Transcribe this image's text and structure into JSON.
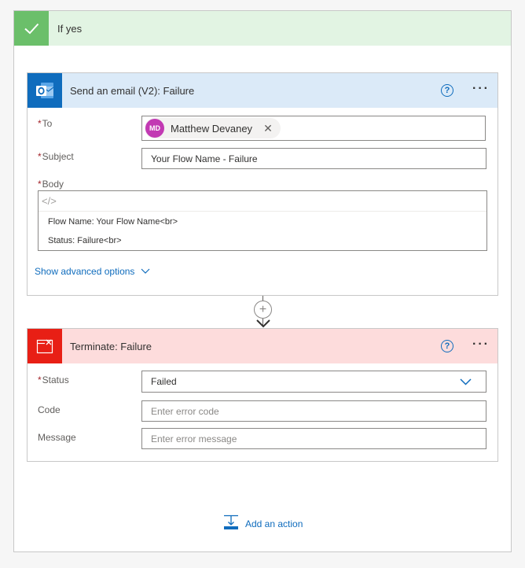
{
  "branch": {
    "title": "If yes",
    "accent_color": "#6bbf6a",
    "header_color": "#e2f4e3"
  },
  "email_card": {
    "title": "Send an email (V2): Failure",
    "icon": "outlook-icon",
    "header_color": "#dbeaf8",
    "help_label": "?",
    "more_label": "···",
    "to": {
      "required_mark": "*",
      "label": "To",
      "recipient_initials": "MD",
      "recipient_name": "Matthew Devaney",
      "remove_label": "✕"
    },
    "subject": {
      "required_mark": "*",
      "label": "Subject",
      "value": "Your Flow Name - Failure"
    },
    "body": {
      "required_mark": "*",
      "label": "Body",
      "code_toggle": "</>",
      "lines": [
        "Flow Name: Your Flow Name<br>",
        "Status: Failure<br>"
      ]
    },
    "advanced_label": "Show advanced options"
  },
  "connector": {
    "plus_label": "+"
  },
  "terminate_card": {
    "title": "Terminate: Failure",
    "icon": "terminate-icon",
    "header_color": "#fddcdc",
    "icon_color": "#e81f15",
    "help_label": "?",
    "more_label": "···",
    "status": {
      "required_mark": "*",
      "label": "Status",
      "value": "Failed"
    },
    "code": {
      "label": "Code",
      "placeholder": "Enter error code"
    },
    "message": {
      "label": "Message",
      "placeholder": "Enter error message"
    }
  },
  "add_action": {
    "label": "Add an action"
  }
}
